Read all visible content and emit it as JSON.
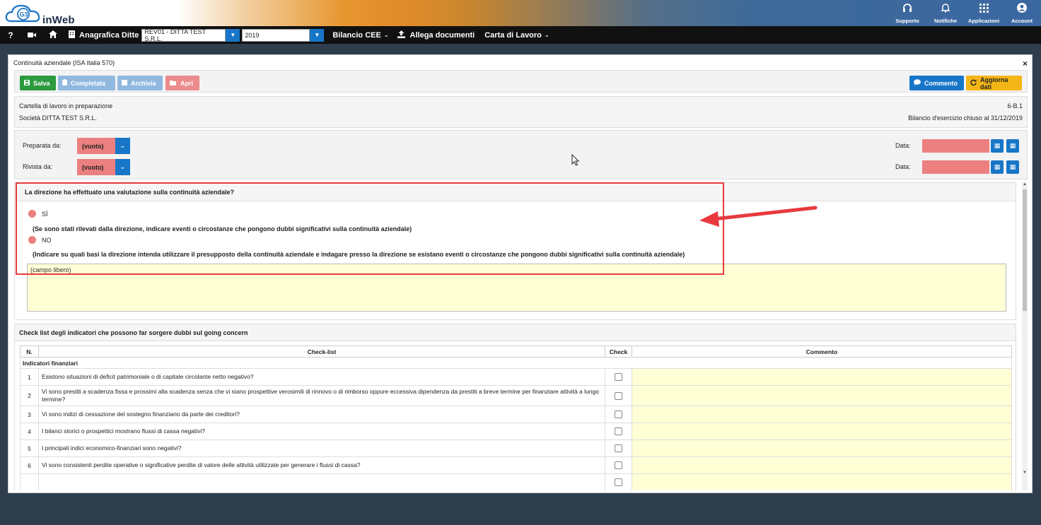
{
  "brand": {
    "name": "inWeb",
    "logo_mark": "G3"
  },
  "top_actions": [
    {
      "label": "Supporto",
      "icon": "headset-icon"
    },
    {
      "label": "Notifiche",
      "icon": "bell-icon"
    },
    {
      "label": "Applicazioni",
      "icon": "grid-icon"
    },
    {
      "label": "Account",
      "icon": "user-circle-icon"
    }
  ],
  "nav": {
    "anagrafica_label": "Anagrafica Ditte",
    "company_value": "REV01 - DITTA TEST S.R.L.",
    "year_value": "2019",
    "bilancio_label": "Bilancio CEE",
    "allega_label": "Allega documenti",
    "carta_label": "Carta di Lavoro"
  },
  "modal": {
    "title": "Continuità aziendale (ISA Italia 570)",
    "close": "×",
    "buttons": {
      "salva": "Salva",
      "completata": "Completata",
      "archivia": "Archivia",
      "apri": "Apri",
      "commento": "Commento",
      "aggiorna": "Aggiorna dati"
    },
    "info": {
      "status": "Cartella di lavoro in preparazione",
      "company": "Società DITTA TEST S.R.L.",
      "code": "6-B.1",
      "bilancio": "Bilancio d'esercizio chiuso al 31/12/2019"
    },
    "prep": {
      "preparata_label": "Preparata da:",
      "rivista_label": "Rivista da:",
      "preparata_value": "(vuoto)",
      "rivista_value": "(vuoto)",
      "data_label": "Data:"
    },
    "question": {
      "title": "La direzione ha effettuato una valutazione sulla continuità aziendale?",
      "opt_si": "SÌ",
      "note_si": "(Se sono stati rilevati dalla direzione, indicare eventi o circostanze che pongono dubbi significativi sulla continuità aziendale)",
      "opt_no": "NO",
      "note_no": "(Indicare su quali basi la direzione intenda utilizzare il presupposto della continuità aziendale e indagare presso la direzione se esistano eventi o circostanze che pongono dubbi significativi sulla continuità aziendale)",
      "free_placeholder": "(campo libero)"
    },
    "checklist": {
      "title": "Check list degli indicatori che possono far sorgere dubbi sul going concern",
      "headers": {
        "n": "N.",
        "checklist": "Check-list",
        "check": "Check",
        "commento": "Commento"
      },
      "group": "Indicatori finanziari",
      "rows": [
        {
          "n": "1",
          "text": "Esistono situazioni di deficit patrimoniale o di capitale circolante netto negativo?"
        },
        {
          "n": "2",
          "text": "Vi sono prestiti a scadenza fissa e prossimi alla scadenza senza che vi siano prospettive verosimili di rinnovo o di rimborso oppure eccessiva dipendenza da prestiti a breve termine per finanziare attività a lungo termine?"
        },
        {
          "n": "3",
          "text": "Vi sono indizi di cessazione del sostegno finanziario da parte dei creditori?"
        },
        {
          "n": "4",
          "text": "I bilanci storici o prospettici mostrano flussi di cassa negativi?"
        },
        {
          "n": "5",
          "text": "I principali indici economico-finanziari sono negativi?"
        },
        {
          "n": "6",
          "text": "Vi sono consistenti perdite operative o significative perdite di valore delle attività utilizzate per generare i flussi di cassa?"
        }
      ]
    }
  }
}
